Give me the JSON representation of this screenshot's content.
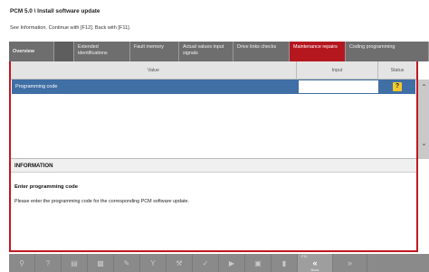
{
  "header": {
    "title": "PCM 5.0 \\ Install software update",
    "subtitle": "See Information. Continue with [F12]. Back with [F11]."
  },
  "tabs": [
    {
      "label": "Overview"
    },
    {
      "label": ""
    },
    {
      "label": "Extended identifications"
    },
    {
      "label": "Fault memory"
    },
    {
      "label": "Actual values input signals"
    },
    {
      "label": "Drive links checks"
    },
    {
      "label": "Maintenance repairs"
    },
    {
      "label": "Coding programming"
    }
  ],
  "table": {
    "columns": [
      "Value",
      "Input",
      "Status"
    ],
    "rows": [
      {
        "value": "Programming code",
        "input": "",
        "status": "?"
      }
    ]
  },
  "info": {
    "header": "INFORMATION",
    "title": "Enter programming code",
    "text": "Please enter the programming code for the corresponding PCM software update."
  },
  "toolbar": {
    "f11_label": "F11",
    "back_symbol": "«",
    "back_label": "Back",
    "next_symbol": "»",
    "icons": [
      "search-icon",
      "help-icon",
      "list-icon",
      "chart-icon",
      "edit-icon",
      "filter-icon",
      "wrench-icon",
      "check-icon",
      "connect-icon",
      "print-icon",
      "settings-icon"
    ]
  },
  "colors": {
    "accent": "#b5171f",
    "selection": "#3f6fa5",
    "status": "#f3c92e",
    "toolbar": "#8a8a8a"
  }
}
